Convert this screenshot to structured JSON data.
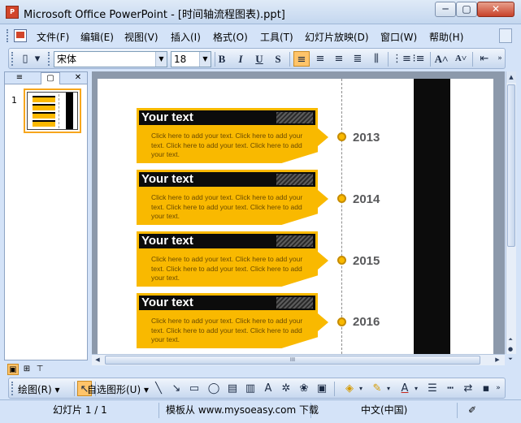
{
  "window": {
    "title": "Microsoft Office PowerPoint - [时间轴流程图表).ppt]",
    "app_icon_letters": "P",
    "controls": {
      "minimize": "─",
      "maximize": "▢",
      "close": "✕"
    }
  },
  "menubar": {
    "items": [
      "文件(F)",
      "编辑(E)",
      "视图(V)",
      "插入(I)",
      "格式(O)",
      "工具(T)",
      "幻灯片放映(D)",
      "窗口(W)",
      "帮助(H)"
    ]
  },
  "formatting": {
    "font_name": "宋体",
    "font_size": "18",
    "bold": "B",
    "italic": "I",
    "underline": "U",
    "shadow": "S",
    "align_left_active": true,
    "increase_font": "A",
    "decrease_font": "A"
  },
  "left_panel": {
    "tab_outline": "≡",
    "tab_slides": "▢",
    "close": "✕",
    "slide_number": "1"
  },
  "slide": {
    "items": [
      {
        "title": "Your text",
        "body": "Click here to add your text. Click here to add your text. Click here to add your text. Click here to add your text.",
        "year": "2013"
      },
      {
        "title": "Your text",
        "body": "Click here to add your text. Click here to add your text. Click here to add your text. Click here to add your text.",
        "year": "2014"
      },
      {
        "title": "Your text",
        "body": "Click here to add your text. Click here to add your text. Click here to add your text. Click here to add your text.",
        "year": "2015"
      },
      {
        "title": "Your text",
        "body": "Click here to add your text. Click here to add your text. Click here to add your text. Click here to add your text.",
        "year": "2016"
      }
    ],
    "colors": {
      "accent": "#f9b900",
      "dark": "#0c0c0c",
      "year_text": "#58595b"
    }
  },
  "hscroll_grip": "III",
  "drawing": {
    "draw_menu": "绘图(R)",
    "autoshapes_menu": "自选图形(U)"
  },
  "status": {
    "slide_info": "幻灯片 1 / 1",
    "template": "模板从 www.mysoeasy.com 下载",
    "language": "中文(中国)"
  }
}
